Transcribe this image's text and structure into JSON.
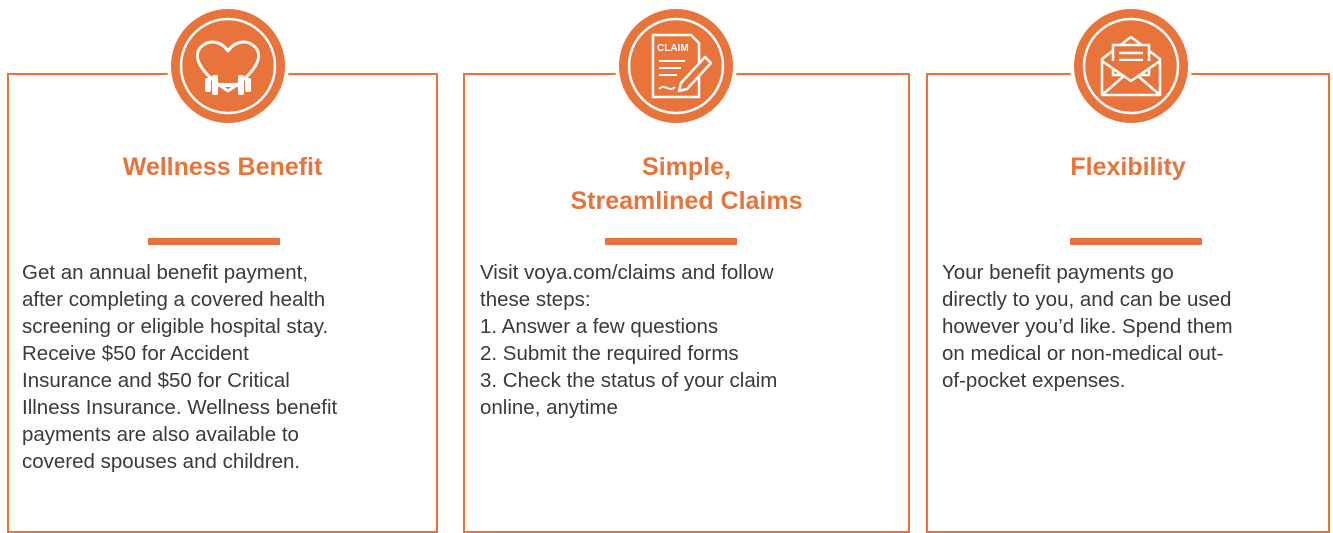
{
  "cards": [
    {
      "icon": "heart-dumbbell-icon",
      "title": "Wellness Benefit",
      "lines": [
        "Get an annual benefit payment,",
        "after completing a covered health",
        "screening or eligible hospital stay.",
        "Receive $50 for Accident",
        "Insurance and $50 for Critical",
        "Illness Insurance. Wellness benefit",
        "payments are also available to",
        "covered spouses and children."
      ]
    },
    {
      "icon": "claim-form-icon",
      "icon_text": "CLAIM",
      "title_lines": [
        "Simple,",
        "Streamlined Claims"
      ],
      "lines": [
        "Visit voya.com/claims and follow",
        "these steps:",
        "1. Answer a few questions",
        "2. Submit the required forms",
        "3. Check the status of your claim",
        "online, anytime"
      ]
    },
    {
      "icon": "envelope-icon",
      "title": "Flexibility",
      "lines": [
        "Your benefit payments go",
        "directly to you, and can be used",
        "however you’d like. Spend them",
        "on medical or non-medical out-",
        "of-pocket expenses."
      ]
    }
  ],
  "colors": {
    "accent": "#e8743b",
    "text": "#3a3a3a"
  }
}
